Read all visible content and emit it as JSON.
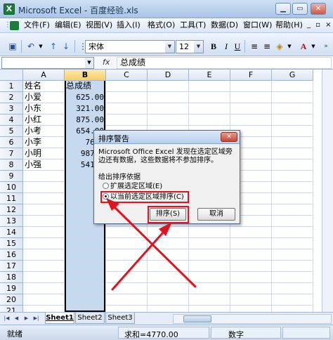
{
  "window": {
    "title": "Microsoft Excel - 百度经验.xls",
    "app_icon": "X"
  },
  "menu": {
    "items": [
      {
        "label": "文件(F)"
      },
      {
        "label": "编辑(E)"
      },
      {
        "label": "视图(V)"
      },
      {
        "label": "插入(I)"
      },
      {
        "label": "格式(O)"
      },
      {
        "label": "工具(T)"
      },
      {
        "label": "数据(D)"
      },
      {
        "label": "窗口(W)"
      },
      {
        "label": "帮助(H)"
      }
    ],
    "close_doc": "_ ▫ ×"
  },
  "toolbar": {
    "font_name": "宋体",
    "font_size": "12"
  },
  "formula_bar": {
    "name_box": "",
    "fx": "fx",
    "content": "总成绩"
  },
  "sheet": {
    "columns": [
      "A",
      "B",
      "C",
      "D",
      "E",
      "F",
      "G"
    ],
    "rows": [
      "1",
      "2",
      "3",
      "4",
      "5",
      "6",
      "7",
      "8",
      "9",
      "10",
      "11",
      "12",
      "13",
      "14",
      "15",
      "16",
      "17",
      "18",
      "19",
      "20",
      "21"
    ],
    "col_a": [
      "姓名",
      "小爱",
      "小东",
      "小红",
      "小考",
      "小李",
      "小明",
      "小强"
    ],
    "col_b": [
      "总成绩",
      "625.00",
      "321.00",
      "875.00",
      "654.00",
      "767.",
      "987.0",
      "541.0"
    ]
  },
  "dialog": {
    "title": "排序警告",
    "message": "Microsoft Office Excel 发现在选定区域旁边还有数据，这些数据将不参加排序。",
    "group_label": "给出排序依据",
    "option_expand": "扩展选定区域(E)",
    "option_current": "以当前选定区域排序(C)",
    "sort_button": "排序(S)",
    "cancel_button": "取消"
  },
  "tabs": [
    "Sheet1",
    "Sheet2",
    "Sheet3"
  ],
  "status": {
    "ready": "就绪",
    "sum": "求和=4770.00",
    "mode": "数字"
  },
  "colors": {
    "highlight": "#e0141e",
    "selection": "#c5d9f1"
  }
}
